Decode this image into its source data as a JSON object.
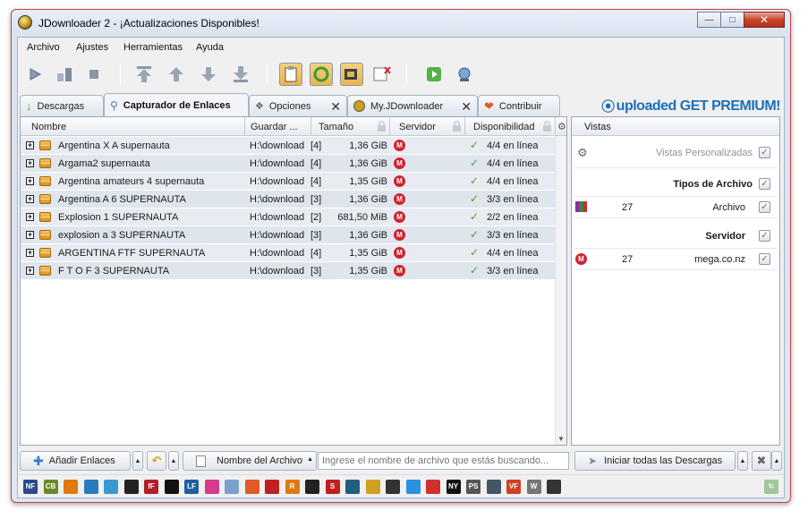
{
  "window": {
    "title": "JDownloader 2 - ¡Actualizaciones Disponibles!"
  },
  "menu": [
    "Archivo",
    "Ajustes",
    "Herramientas",
    "Ayuda"
  ],
  "tabs": [
    {
      "label": "Descargas"
    },
    {
      "label": "Capturador de Enlaces",
      "active": true
    },
    {
      "label": "Opciones"
    },
    {
      "label": "My.JDownloader"
    },
    {
      "label": "Contribuir"
    }
  ],
  "premium": {
    "brand": "uploaded",
    "cta": "GET PREMIUM!"
  },
  "table": {
    "columns": [
      "Nombre",
      "Guardar ...",
      "Tamaño",
      "Servidor",
      "Disponibilidad"
    ],
    "rows": [
      {
        "name": "Argentina X A supernauta",
        "save": "H:\\download",
        "count": "[4]",
        "size": "1,36 GiB",
        "avail": "4/4 en línea"
      },
      {
        "name": "Argama2 supernauta",
        "save": "H:\\download",
        "count": "[4]",
        "size": "1,36 GiB",
        "avail": "4/4 en línea"
      },
      {
        "name": "Argentina amateurs 4 supernauta",
        "save": "H:\\download",
        "count": "[4]",
        "size": "1,35 GiB",
        "avail": "4/4 en línea"
      },
      {
        "name": "Argentina A 6 SUPERNAUTA",
        "save": "H:\\download",
        "count": "[3]",
        "size": "1,36 GiB",
        "avail": "3/3 en línea"
      },
      {
        "name": "Explosion 1 SUPERNAUTA",
        "save": "H:\\download",
        "count": "[2]",
        "size": "681,50 MiB",
        "avail": "2/2 en línea"
      },
      {
        "name": "explosion a 3 SUPERNAUTA",
        "save": "H:\\download",
        "count": "[3]",
        "size": "1,36 GiB",
        "avail": "3/3 en línea"
      },
      {
        "name": "ARGENTINA FTF SUPERNAUTA",
        "save": "H:\\download",
        "count": "[4]",
        "size": "1,35 GiB",
        "avail": "4/4 en línea"
      },
      {
        "name": "F T O F 3 SUPERNAUTA",
        "save": "H:\\download",
        "count": "[3]",
        "size": "1,35 GiB",
        "avail": "3/3 en línea"
      }
    ]
  },
  "side": {
    "header": "Vistas",
    "custom_views": "Vistas Personalizadas",
    "file_types_title": "Tipos de Archivo",
    "file_type": {
      "count": "27",
      "label": "Archivo"
    },
    "server_title": "Servidor",
    "server": {
      "count": "27",
      "label": "mega.co.nz"
    }
  },
  "bottom": {
    "add_links": "Añadir Enlaces",
    "filename_field": "Nombre del Archivo",
    "search_placeholder": "Ingrese el nombre de archivo que estás buscando...",
    "start_all": "Iniciar todas las Descargas"
  },
  "status_icons": [
    "NF",
    "CB",
    "",
    "",
    "",
    "",
    "fF",
    "",
    "LF",
    "",
    "",
    "",
    "",
    "R",
    "",
    "S",
    "",
    "",
    "",
    "",
    "",
    "NY",
    "PS",
    "",
    "VF",
    "W",
    ""
  ],
  "colors": {
    "mega": "#d0232e",
    "accent": "#1d6fb8",
    "row_alt": "#e8ecf2",
    "row": "#dfe5ec"
  }
}
